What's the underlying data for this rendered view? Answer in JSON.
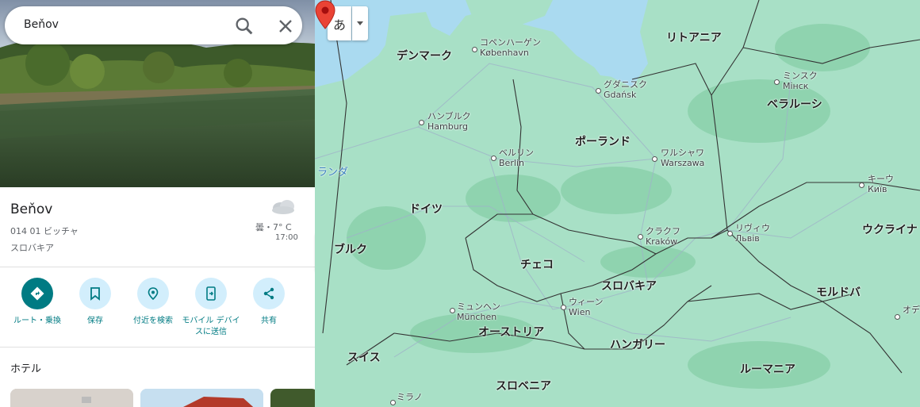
{
  "search": {
    "query": "Beňov"
  },
  "place": {
    "title": "Beňov",
    "postal": "014 01 ビッチャ",
    "country": "スロバキア"
  },
  "weather": {
    "temp": "曇・7° C",
    "time": "17:00"
  },
  "actions": [
    {
      "label": "ルート・乗換",
      "icon": "directions-icon"
    },
    {
      "label": "保存",
      "icon": "bookmark-icon"
    },
    {
      "label": "付近を検索",
      "icon": "nearby-icon"
    },
    {
      "label": "モバイル デバイスに送信",
      "icon": "send-to-phone-icon"
    },
    {
      "label": "共有",
      "icon": "share-icon"
    }
  ],
  "hotels_label": "ホテル",
  "map": {
    "lang_button": "あ",
    "countries": [
      "デンマーク",
      "リトアニア",
      "ベラルーシ",
      "ポーランド",
      "ドイツ",
      "チェコ",
      "スロバキア",
      "ウクライナ",
      "オーストリア",
      "ハンガリー",
      "スイス",
      "スロベニア",
      "ルーマニア",
      "モルドバ",
      "ブルク",
      "ランダ"
    ],
    "cities": [
      {
        "jp": "コペンハーゲン",
        "native": "København"
      },
      {
        "jp": "グダニスク",
        "native": "Gdańsk"
      },
      {
        "jp": "ミンスク",
        "native": "Мінск"
      },
      {
        "jp": "ハンブルク",
        "native": "Hamburg"
      },
      {
        "jp": "ベルリン",
        "native": "Berlin"
      },
      {
        "jp": "ワルシャワ",
        "native": "Warszawa"
      },
      {
        "jp": "キーウ",
        "native": "Київ"
      },
      {
        "jp": "リヴィウ",
        "native": "Львів"
      },
      {
        "jp": "クラクフ",
        "native": "Kraków"
      },
      {
        "jp": "ミュンヘン",
        "native": "München"
      },
      {
        "jp": "ウィーン",
        "native": "Wien"
      },
      {
        "jp": "ミラノ",
        "native": ""
      },
      {
        "jp": "オデ",
        "native": ""
      }
    ],
    "colors": {
      "water": "#aadaf0",
      "land": "#a8e0c6",
      "forest": "#8fd3af",
      "border": "#333333"
    }
  }
}
